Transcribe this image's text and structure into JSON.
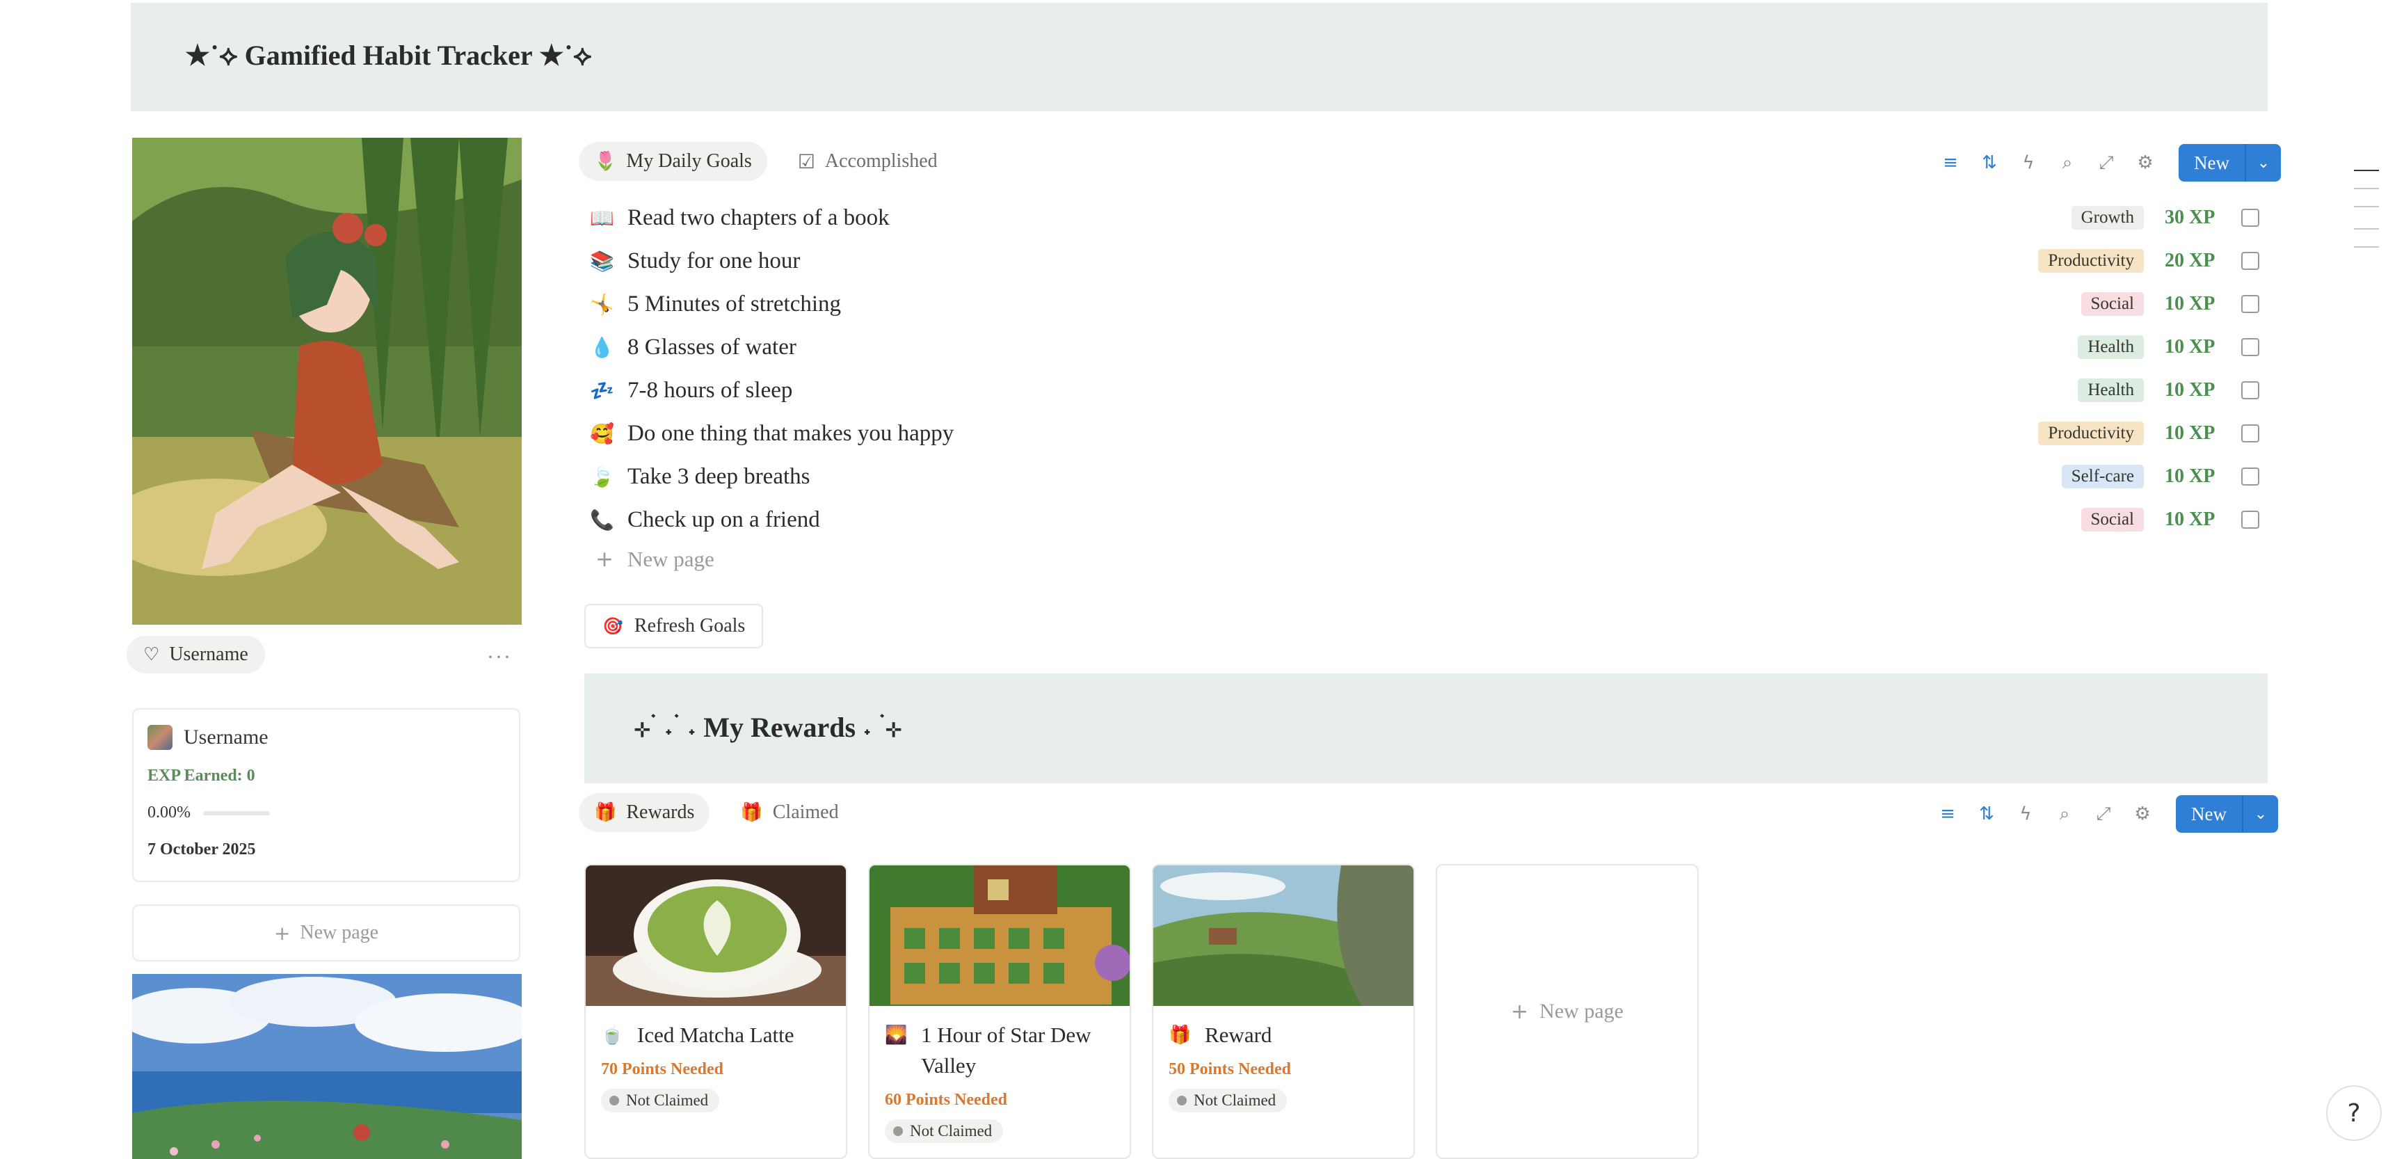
{
  "header": {
    "title": "★˙⟡ Gamified Habit Tracker ★˙⟡"
  },
  "profile": {
    "chip_label": "Username",
    "more": "···",
    "card_name": "Username",
    "exp": "EXP Earned: 0",
    "progress_text": "0.00%",
    "progress": 0,
    "date": "7 October 2025",
    "new_page": "New page"
  },
  "goals": {
    "tabs": [
      {
        "label": "My Daily Goals",
        "icon": "🌷"
      },
      {
        "label": "Accomplished",
        "icon": "☑"
      }
    ],
    "new_label": "New",
    "items": [
      {
        "icon": "📖",
        "text": "Read two chapters of a book",
        "tag": "Growth",
        "xp": "30 XP"
      },
      {
        "icon": "📚",
        "text": "Study for one hour",
        "tag": "Productivity",
        "xp": "20 XP"
      },
      {
        "icon": "🤸",
        "text": "5 Minutes of stretching",
        "tag": "Social",
        "xp": "10 XP"
      },
      {
        "icon": "💧",
        "text": "8 Glasses of water",
        "tag": "Health",
        "xp": "10 XP"
      },
      {
        "icon": "💤",
        "text": "7-8 hours of sleep",
        "tag": "Health",
        "xp": "10 XP"
      },
      {
        "icon": "🥰",
        "text": "Do one thing that makes you happy",
        "tag": "Productivity",
        "xp": "10 XP"
      },
      {
        "icon": "🍃",
        "text": "Take 3 deep breaths",
        "tag": "Self-care",
        "xp": "10 XP"
      },
      {
        "icon": "📞",
        "text": "Check up on a friend",
        "tag": "Social",
        "xp": "10 XP"
      }
    ],
    "new_page": "New page",
    "refresh": "Refresh Goals",
    "refresh_icon": "🎯"
  },
  "tag_colors": {
    "Growth": "#eeeeec",
    "Productivity": "#f6e4c4",
    "Social": "#f8dde3",
    "Health": "#dcece0",
    "Self-care": "#d9e6f5"
  },
  "rewards": {
    "title": "⊹ ࣪ ˖ ࣪ ˖ My Rewards ˖ ࣪ ⊹",
    "tabs": [
      {
        "label": "Rewards",
        "icon": "🎁"
      },
      {
        "label": "Claimed",
        "icon": "🎁"
      }
    ],
    "new_label": "New",
    "cards": [
      {
        "icon": "🍵",
        "title": "Iced Matcha Latte",
        "points": "70 Points Needed",
        "status": "Not Claimed"
      },
      {
        "icon": "🌄",
        "title": "1 Hour of Star Dew Valley",
        "points": "60 Points Needed",
        "status": "Not Claimed"
      },
      {
        "icon": "🎁",
        "title": "Reward",
        "points": "50 Points Needed",
        "status": "Not Claimed"
      }
    ],
    "new_page": "New page"
  }
}
